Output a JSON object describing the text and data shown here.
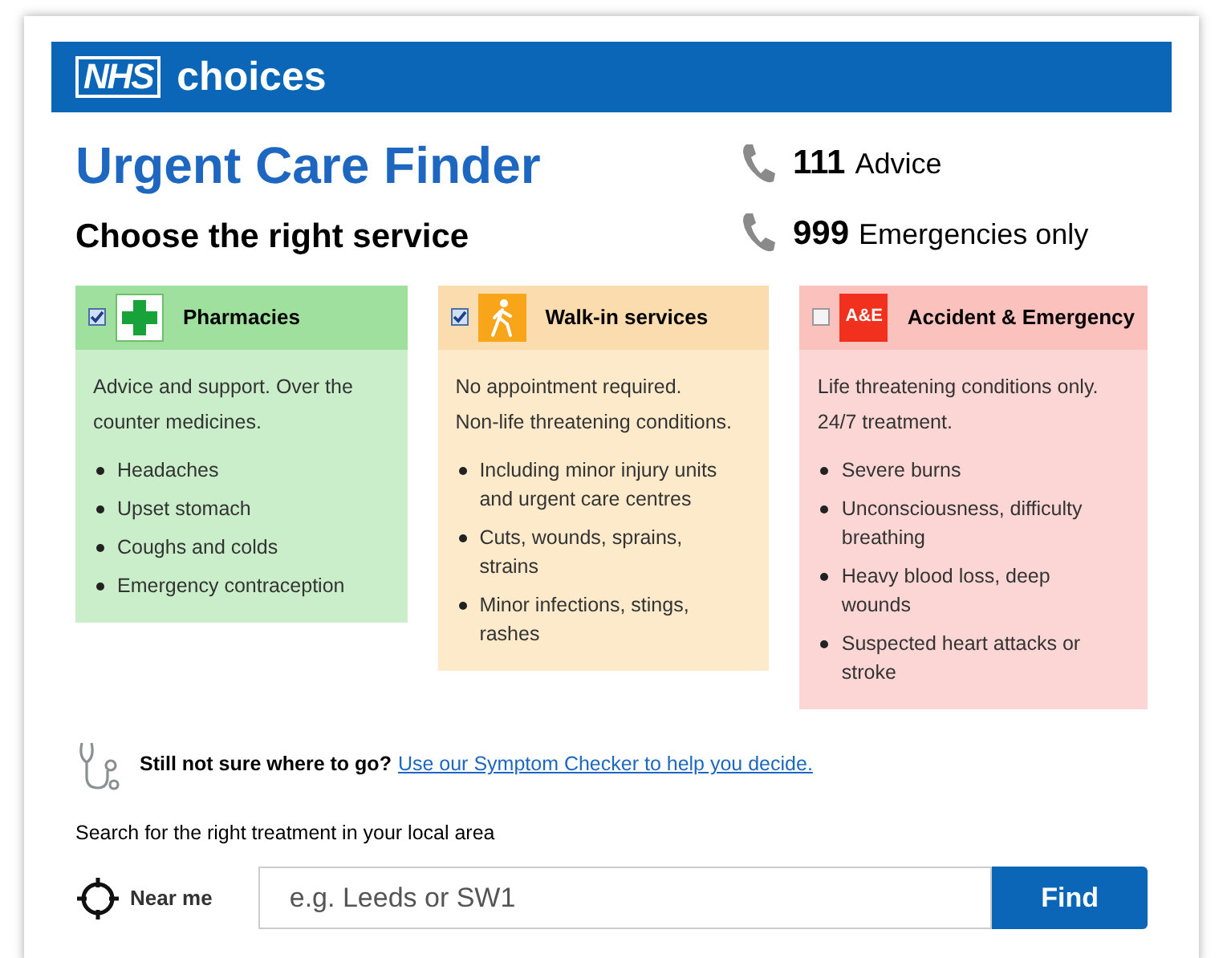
{
  "header": {
    "logo_mark": "NHS",
    "logo_word": "choices"
  },
  "title": "Urgent Care Finder",
  "subtitle": "Choose the right service",
  "phones": [
    {
      "number": "111",
      "label": "Advice"
    },
    {
      "number": "999",
      "label": "Emergencies only"
    }
  ],
  "services": [
    {
      "kind": "pharmacy",
      "title": "Pharmacies",
      "checked": true,
      "description": [
        "Advice and support. Over the counter medicines."
      ],
      "items": [
        "Headaches",
        "Upset stomach",
        "Coughs and colds",
        "Emergency contraception"
      ]
    },
    {
      "kind": "walkin",
      "title": "Walk-in services",
      "checked": true,
      "description": [
        "No appointment required.",
        "Non-life threatening conditions."
      ],
      "items": [
        "Including minor injury units and urgent care centres",
        "Cuts, wounds, sprains, strains",
        "Minor infections, stings, rashes"
      ]
    },
    {
      "kind": "ae",
      "title": "Accident & Emergency",
      "badge": "A&E",
      "checked": false,
      "description": [
        "Life threatening conditions only.",
        "24/7 treatment."
      ],
      "items": [
        "Severe burns",
        "Unconsciousness, difficulty breathing",
        "Heavy blood loss, deep wounds",
        "Suspected heart attacks or stroke"
      ]
    }
  ],
  "symptom": {
    "question": "Still not sure where to go?",
    "link": "Use our Symptom Checker to help you decide."
  },
  "search": {
    "label": "Search for the right treatment in your local area",
    "near_me": "Near me",
    "placeholder": "e.g. Leeds or SW1",
    "button": "Find"
  }
}
